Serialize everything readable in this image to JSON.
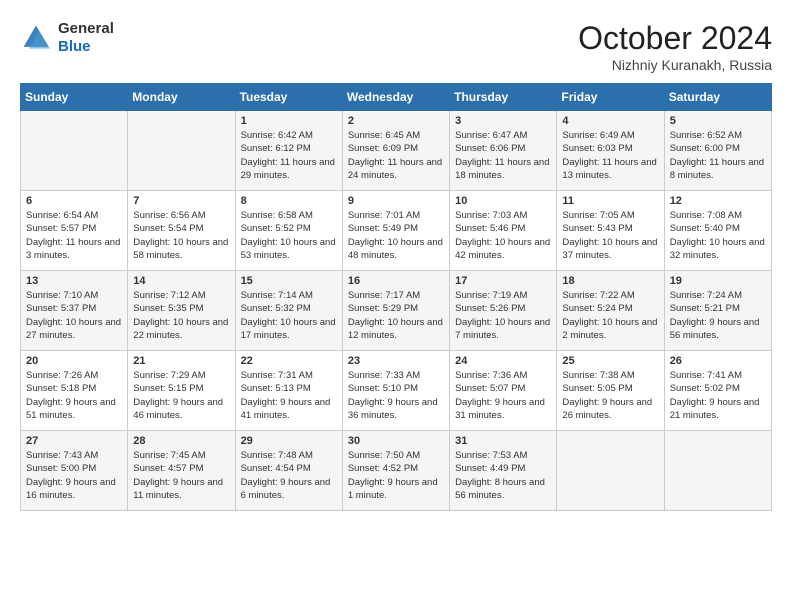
{
  "header": {
    "logo_general": "General",
    "logo_blue": "Blue",
    "month_title": "October 2024",
    "subtitle": "Nizhniy Kuranakh, Russia"
  },
  "weekdays": [
    "Sunday",
    "Monday",
    "Tuesday",
    "Wednesday",
    "Thursday",
    "Friday",
    "Saturday"
  ],
  "weeks": [
    [
      {
        "day": "",
        "info": ""
      },
      {
        "day": "",
        "info": ""
      },
      {
        "day": "1",
        "info": "Sunrise: 6:42 AM\nSunset: 6:12 PM\nDaylight: 11 hours and 29 minutes."
      },
      {
        "day": "2",
        "info": "Sunrise: 6:45 AM\nSunset: 6:09 PM\nDaylight: 11 hours and 24 minutes."
      },
      {
        "day": "3",
        "info": "Sunrise: 6:47 AM\nSunset: 6:06 PM\nDaylight: 11 hours and 18 minutes."
      },
      {
        "day": "4",
        "info": "Sunrise: 6:49 AM\nSunset: 6:03 PM\nDaylight: 11 hours and 13 minutes."
      },
      {
        "day": "5",
        "info": "Sunrise: 6:52 AM\nSunset: 6:00 PM\nDaylight: 11 hours and 8 minutes."
      }
    ],
    [
      {
        "day": "6",
        "info": "Sunrise: 6:54 AM\nSunset: 5:57 PM\nDaylight: 11 hours and 3 minutes."
      },
      {
        "day": "7",
        "info": "Sunrise: 6:56 AM\nSunset: 5:54 PM\nDaylight: 10 hours and 58 minutes."
      },
      {
        "day": "8",
        "info": "Sunrise: 6:58 AM\nSunset: 5:52 PM\nDaylight: 10 hours and 53 minutes."
      },
      {
        "day": "9",
        "info": "Sunrise: 7:01 AM\nSunset: 5:49 PM\nDaylight: 10 hours and 48 minutes."
      },
      {
        "day": "10",
        "info": "Sunrise: 7:03 AM\nSunset: 5:46 PM\nDaylight: 10 hours and 42 minutes."
      },
      {
        "day": "11",
        "info": "Sunrise: 7:05 AM\nSunset: 5:43 PM\nDaylight: 10 hours and 37 minutes."
      },
      {
        "day": "12",
        "info": "Sunrise: 7:08 AM\nSunset: 5:40 PM\nDaylight: 10 hours and 32 minutes."
      }
    ],
    [
      {
        "day": "13",
        "info": "Sunrise: 7:10 AM\nSunset: 5:37 PM\nDaylight: 10 hours and 27 minutes."
      },
      {
        "day": "14",
        "info": "Sunrise: 7:12 AM\nSunset: 5:35 PM\nDaylight: 10 hours and 22 minutes."
      },
      {
        "day": "15",
        "info": "Sunrise: 7:14 AM\nSunset: 5:32 PM\nDaylight: 10 hours and 17 minutes."
      },
      {
        "day": "16",
        "info": "Sunrise: 7:17 AM\nSunset: 5:29 PM\nDaylight: 10 hours and 12 minutes."
      },
      {
        "day": "17",
        "info": "Sunrise: 7:19 AM\nSunset: 5:26 PM\nDaylight: 10 hours and 7 minutes."
      },
      {
        "day": "18",
        "info": "Sunrise: 7:22 AM\nSunset: 5:24 PM\nDaylight: 10 hours and 2 minutes."
      },
      {
        "day": "19",
        "info": "Sunrise: 7:24 AM\nSunset: 5:21 PM\nDaylight: 9 hours and 56 minutes."
      }
    ],
    [
      {
        "day": "20",
        "info": "Sunrise: 7:26 AM\nSunset: 5:18 PM\nDaylight: 9 hours and 51 minutes."
      },
      {
        "day": "21",
        "info": "Sunrise: 7:29 AM\nSunset: 5:15 PM\nDaylight: 9 hours and 46 minutes."
      },
      {
        "day": "22",
        "info": "Sunrise: 7:31 AM\nSunset: 5:13 PM\nDaylight: 9 hours and 41 minutes."
      },
      {
        "day": "23",
        "info": "Sunrise: 7:33 AM\nSunset: 5:10 PM\nDaylight: 9 hours and 36 minutes."
      },
      {
        "day": "24",
        "info": "Sunrise: 7:36 AM\nSunset: 5:07 PM\nDaylight: 9 hours and 31 minutes."
      },
      {
        "day": "25",
        "info": "Sunrise: 7:38 AM\nSunset: 5:05 PM\nDaylight: 9 hours and 26 minutes."
      },
      {
        "day": "26",
        "info": "Sunrise: 7:41 AM\nSunset: 5:02 PM\nDaylight: 9 hours and 21 minutes."
      }
    ],
    [
      {
        "day": "27",
        "info": "Sunrise: 7:43 AM\nSunset: 5:00 PM\nDaylight: 9 hours and 16 minutes."
      },
      {
        "day": "28",
        "info": "Sunrise: 7:45 AM\nSunset: 4:57 PM\nDaylight: 9 hours and 11 minutes."
      },
      {
        "day": "29",
        "info": "Sunrise: 7:48 AM\nSunset: 4:54 PM\nDaylight: 9 hours and 6 minutes."
      },
      {
        "day": "30",
        "info": "Sunrise: 7:50 AM\nSunset: 4:52 PM\nDaylight: 9 hours and 1 minute."
      },
      {
        "day": "31",
        "info": "Sunrise: 7:53 AM\nSunset: 4:49 PM\nDaylight: 8 hours and 56 minutes."
      },
      {
        "day": "",
        "info": ""
      },
      {
        "day": "",
        "info": ""
      }
    ]
  ]
}
